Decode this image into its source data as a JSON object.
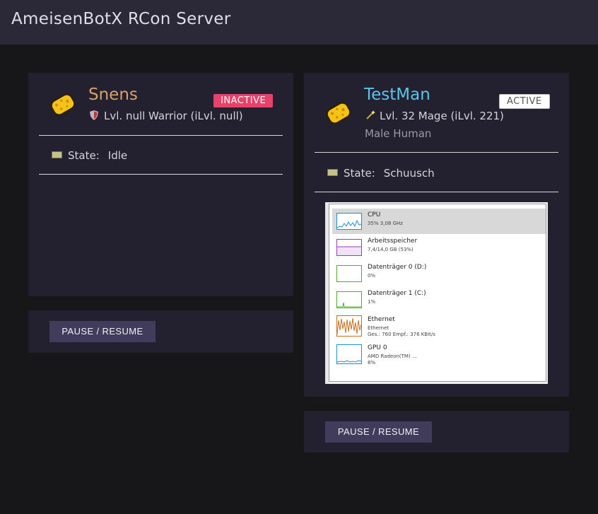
{
  "app": {
    "title": "AmeisenBotX RCon Server"
  },
  "colors": {
    "inactive_badge": "#e8416a",
    "active_badge": "#ffffff",
    "bot1_name": "#d9a06a",
    "bot2_name": "#5cc3ea",
    "button_bg": "#413c5c",
    "card_bg": "#232130"
  },
  "bots": [
    {
      "name": "Snens",
      "status": "INACTIVE",
      "avatar_icon": "sponge-icon",
      "class_icon": "shield-icon",
      "class_line": "Lvl. null Warrior (iLvl. null)",
      "state_label": "State:",
      "state_value": "Idle",
      "button_label": "PAUSE / RESUME"
    },
    {
      "name": "TestMan",
      "status": "ACTIVE",
      "avatar_icon": "sponge-icon",
      "class_icon": "wand-icon",
      "class_line": "Lvl. 32 Mage (iLvl. 221)",
      "race_line": "Male Human",
      "state_label": "State:",
      "state_value": "Schuusch",
      "button_label": "PAUSE / RESUME",
      "screenshot": {
        "items": [
          {
            "name": "CPU",
            "detail": "35% 3,08 GHz",
            "color": "#1a8fd6",
            "selected": true
          },
          {
            "name": "Arbeitsspeicher",
            "detail": "7,4/14,0 GB (53%)",
            "color": "#9b3fb8"
          },
          {
            "name": "Datenträger 0 (D:)",
            "detail": "0%",
            "color": "#4caf2a"
          },
          {
            "name": "Datenträger 1 (C:)",
            "detail": "1%",
            "color": "#4caf2a"
          },
          {
            "name": "Ethernet",
            "detail": "Ethernet",
            "detail2": "Ges.: 760 Empf.: 376 KBit/s",
            "color": "#c8701c"
          },
          {
            "name": "GPU 0",
            "detail": "AMD Radeon(TM) ...",
            "detail2": "8%",
            "color": "#1a8fd6"
          }
        ]
      }
    }
  ]
}
